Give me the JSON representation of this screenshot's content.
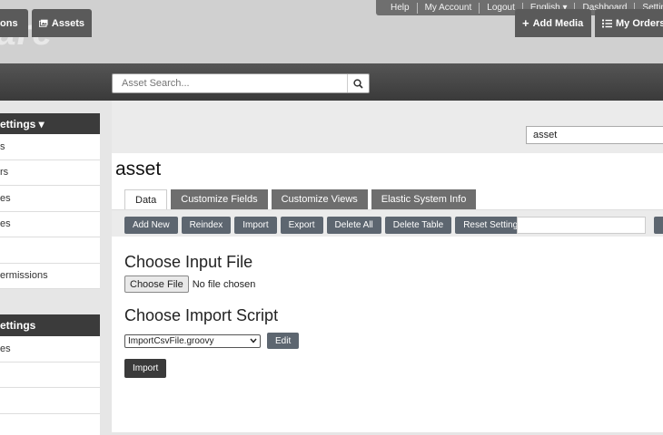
{
  "header": {
    "logo": "hare",
    "links": [
      "Help",
      "My Account",
      "Logout",
      "English ▾",
      "Dashboard",
      "Setting"
    ]
  },
  "nav": {
    "left_tab_partial": "ons",
    "assets_tab": "Assets",
    "search_placeholder": "Asset Search...",
    "add_media": "Add Media",
    "my_orders": "My Orders"
  },
  "sidebar": {
    "panel1": {
      "title": "ettings ▾",
      "items": [
        "s",
        "rs",
        "es",
        "es",
        "",
        "ermissions"
      ]
    },
    "panel2": {
      "title": "ettings",
      "items": [
        "es",
        "",
        "",
        ""
      ]
    }
  },
  "main": {
    "table_select_value": "asset",
    "title": "asset",
    "tabs": [
      "Data",
      "Customize Fields",
      "Customize Views",
      "Elastic System Info"
    ],
    "actions": [
      "Add New",
      "Reindex",
      "Import",
      "Export",
      "Delete All",
      "Delete Table",
      "Reset Settings"
    ],
    "choose_file_heading": "Choose Input File",
    "choose_file_button": "Choose File",
    "no_file_text": "No file chosen",
    "choose_script_heading": "Choose Import Script",
    "script_selected": "ImportCsvFile.groovy",
    "edit_button": "Edit",
    "import_button": "Import"
  }
}
